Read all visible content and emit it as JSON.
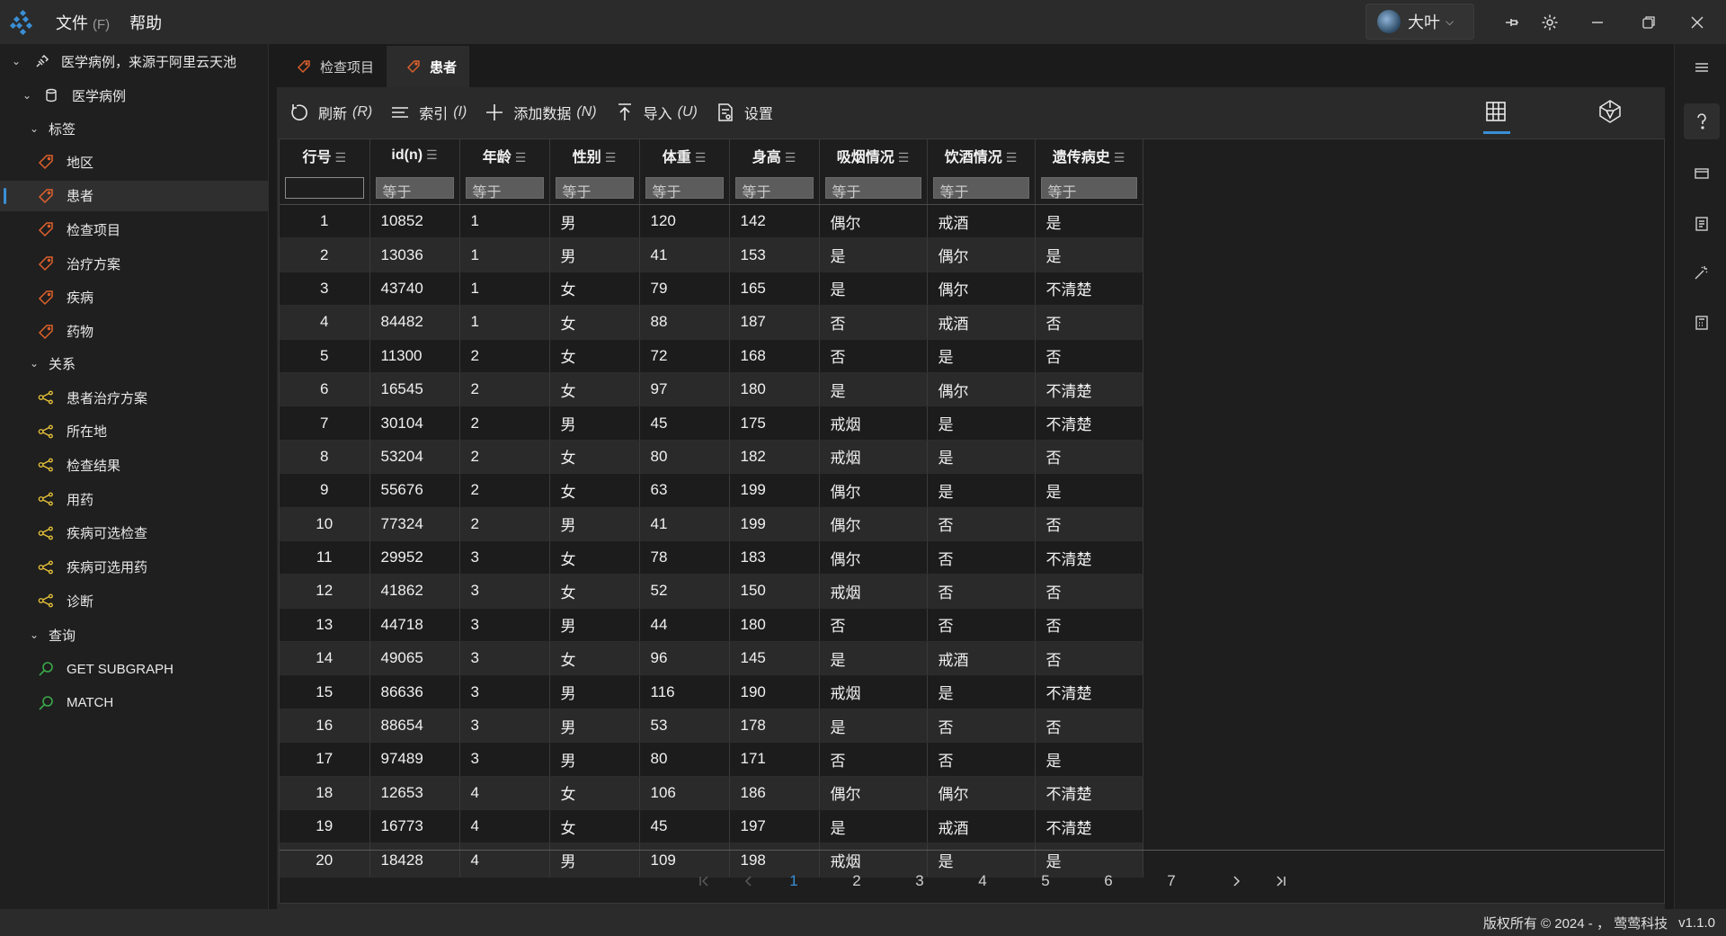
{
  "menu": {
    "file_label": "文件",
    "file_accel": "(F)",
    "help_label": "帮助"
  },
  "user": {
    "name": "大叶"
  },
  "sidebar": {
    "connection": "医学病例，来源于阿里云天池",
    "database": "医学病例",
    "tags_group": "标签",
    "tags": [
      "地区",
      "患者",
      "检查项目",
      "治疗方案",
      "疾病",
      "药物"
    ],
    "relations_group": "关系",
    "relations": [
      "患者治疗方案",
      "所在地",
      "检查结果",
      "用药",
      "疾病可选检查",
      "疾病可选用药",
      "诊断"
    ],
    "queries_group": "查询",
    "queries": [
      "GET SUBGRAPH",
      "MATCH"
    ]
  },
  "tabs": [
    {
      "label": "检查项目"
    },
    {
      "label": "患者"
    }
  ],
  "toolbar": {
    "refresh": "刷新",
    "refresh_accel": "(R)",
    "index": "索引",
    "index_accel": "(I)",
    "add": "添加数据",
    "add_accel": "(N)",
    "import": "导入",
    "import_accel": "(U)",
    "settings": "设置"
  },
  "table": {
    "columns": [
      "行号",
      "id(n)",
      "年龄",
      "性别",
      "体重",
      "身高",
      "吸烟情况",
      "饮酒情况",
      "遗传病史"
    ],
    "filter_placeholder": "等于",
    "rows": [
      [
        "1",
        "10852",
        "1",
        "男",
        "120",
        "142",
        "偶尔",
        "戒酒",
        "是"
      ],
      [
        "2",
        "13036",
        "1",
        "男",
        "41",
        "153",
        "是",
        "偶尔",
        "是"
      ],
      [
        "3",
        "43740",
        "1",
        "女",
        "79",
        "165",
        "是",
        "偶尔",
        "不清楚"
      ],
      [
        "4",
        "84482",
        "1",
        "女",
        "88",
        "187",
        "否",
        "戒酒",
        "否"
      ],
      [
        "5",
        "11300",
        "2",
        "女",
        "72",
        "168",
        "否",
        "是",
        "否"
      ],
      [
        "6",
        "16545",
        "2",
        "女",
        "97",
        "180",
        "是",
        "偶尔",
        "不清楚"
      ],
      [
        "7",
        "30104",
        "2",
        "男",
        "45",
        "175",
        "戒烟",
        "是",
        "不清楚"
      ],
      [
        "8",
        "53204",
        "2",
        "女",
        "80",
        "182",
        "戒烟",
        "是",
        "否"
      ],
      [
        "9",
        "55676",
        "2",
        "女",
        "63",
        "199",
        "偶尔",
        "是",
        "是"
      ],
      [
        "10",
        "77324",
        "2",
        "男",
        "41",
        "199",
        "偶尔",
        "否",
        "否"
      ],
      [
        "11",
        "29952",
        "3",
        "女",
        "78",
        "183",
        "偶尔",
        "否",
        "不清楚"
      ],
      [
        "12",
        "41862",
        "3",
        "女",
        "52",
        "150",
        "戒烟",
        "否",
        "否"
      ],
      [
        "13",
        "44718",
        "3",
        "男",
        "44",
        "180",
        "否",
        "否",
        "否"
      ],
      [
        "14",
        "49065",
        "3",
        "女",
        "96",
        "145",
        "是",
        "戒酒",
        "否"
      ],
      [
        "15",
        "86636",
        "3",
        "男",
        "116",
        "190",
        "戒烟",
        "是",
        "不清楚"
      ],
      [
        "16",
        "88654",
        "3",
        "男",
        "53",
        "178",
        "是",
        "否",
        "否"
      ],
      [
        "17",
        "97489",
        "3",
        "男",
        "80",
        "171",
        "否",
        "否",
        "是"
      ],
      [
        "18",
        "12653",
        "4",
        "女",
        "106",
        "186",
        "偶尔",
        "偶尔",
        "不清楚"
      ],
      [
        "19",
        "16773",
        "4",
        "女",
        "45",
        "197",
        "是",
        "戒酒",
        "不清楚"
      ],
      [
        "20",
        "18428",
        "4",
        "男",
        "109",
        "198",
        "戒烟",
        "是",
        "是"
      ]
    ]
  },
  "pager": {
    "pages": [
      "1",
      "2",
      "3",
      "4",
      "5",
      "6",
      "7"
    ],
    "current": "1"
  },
  "status": {
    "copyright": "版权所有 © 2024 - ， 莺莺科技",
    "version": "v1.1.0"
  },
  "colors": {
    "accent": "#3a8fd6",
    "tag_icon": "#e0612c",
    "relation_icon": "#e8c33a",
    "query_icon": "#3aa84a"
  }
}
